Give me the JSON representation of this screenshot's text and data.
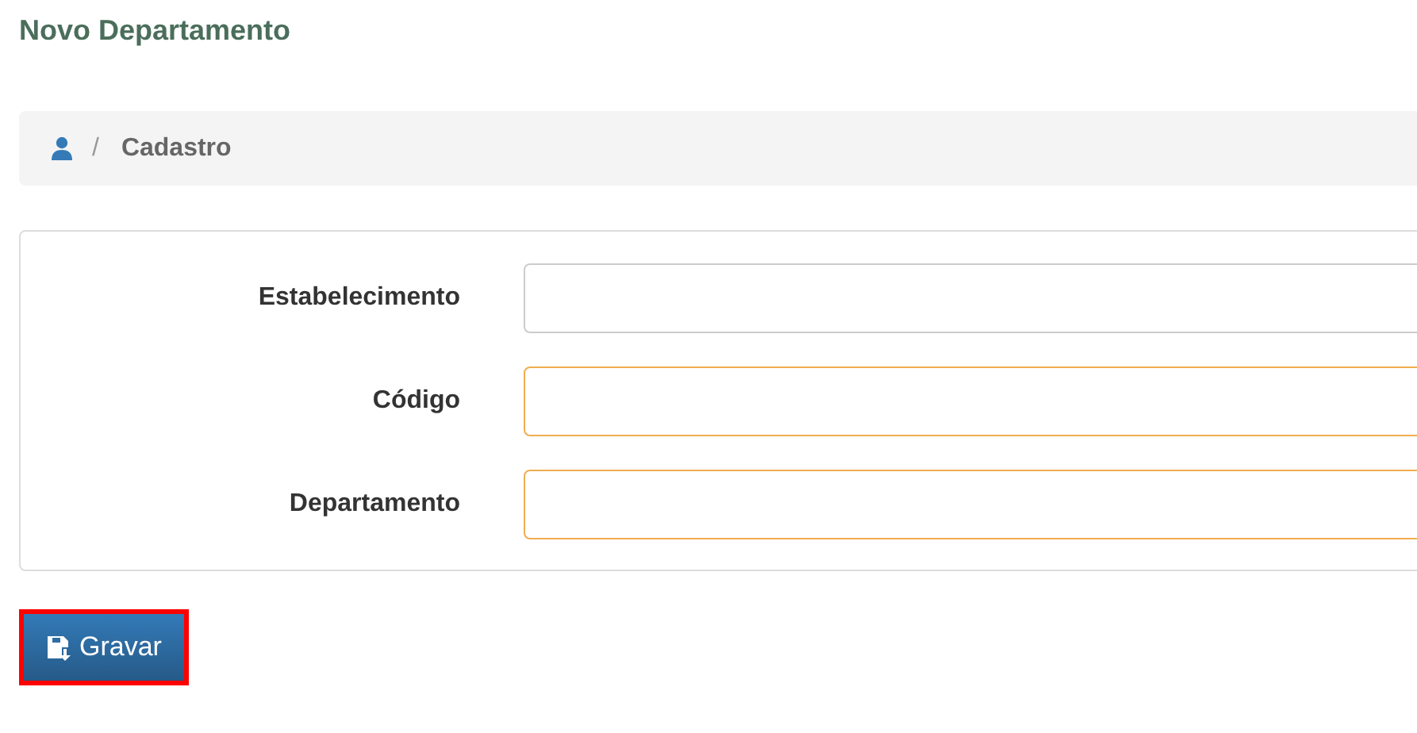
{
  "page": {
    "title": "Novo Departamento"
  },
  "breadcrumb": {
    "separator": "/",
    "items": [
      "Cadastro"
    ]
  },
  "form": {
    "fields": [
      {
        "label": "Estabelecimento",
        "required": false
      },
      {
        "label": "Código",
        "required": true
      },
      {
        "label": "Departamento",
        "required": true
      }
    ]
  },
  "save_button": {
    "label": "Gravar",
    "highlighted": true
  }
}
